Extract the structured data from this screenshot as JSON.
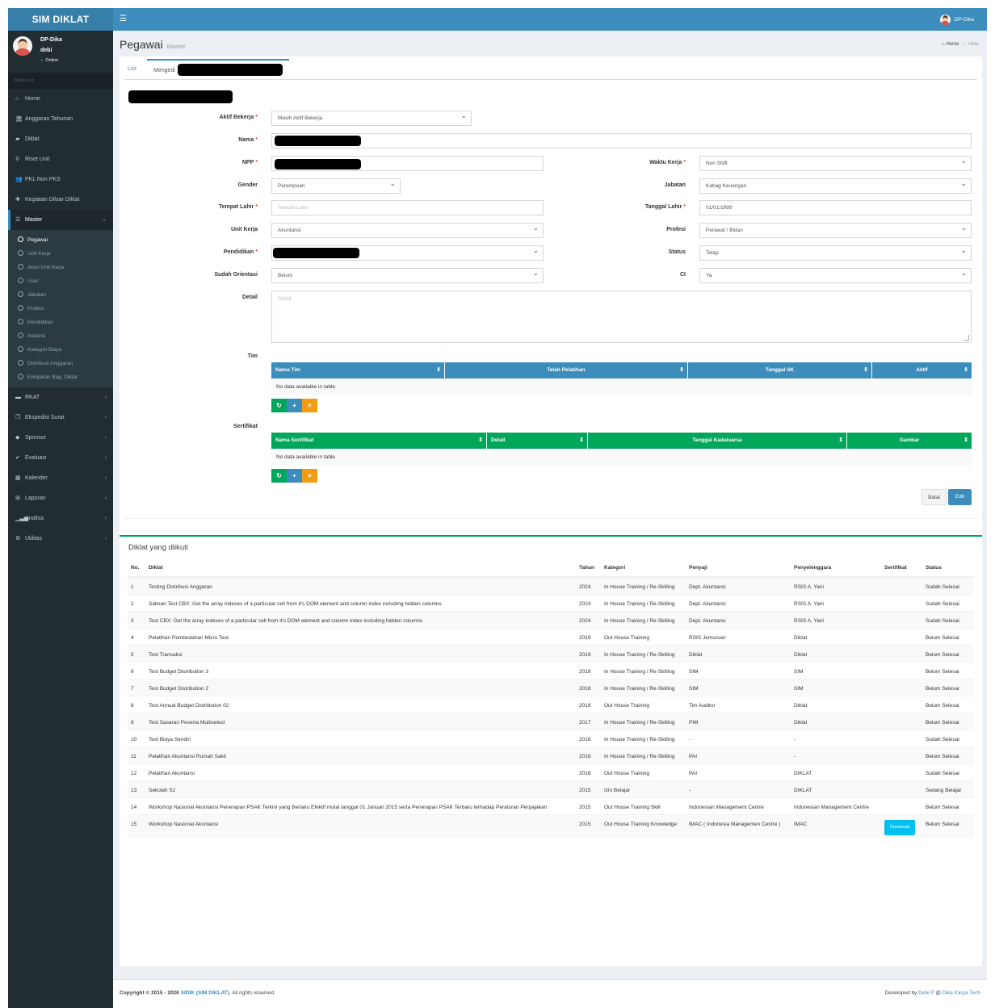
{
  "app": {
    "logo": "SIM DIKLAT",
    "user": "DP-Dika"
  },
  "sidebar": {
    "user_name": "DP-Dika",
    "user_sub": "debi",
    "status": "Online",
    "menu_header": "Menu List",
    "items": [
      {
        "label": "Home",
        "icon": "home-icon",
        "glyph": "⌂"
      },
      {
        "label": "Anggaran Tahunan",
        "icon": "bank-icon",
        "glyph": "🏛"
      },
      {
        "label": "Diklat",
        "icon": "book-icon",
        "glyph": "▰"
      },
      {
        "label": "Riset Unit",
        "icon": "search-icon",
        "glyph": "⚲"
      },
      {
        "label": "PKL Non PKS",
        "icon": "users-icon",
        "glyph": "👥"
      },
      {
        "label": "Kegiatan Diluar Diklat",
        "icon": "puzzle-icon",
        "glyph": "✚"
      },
      {
        "label": "Master",
        "icon": "database-icon",
        "glyph": "☰"
      }
    ],
    "sub": [
      "Pegawai",
      "Unit Kerja",
      "Akun Unit Kerja",
      "User",
      "Jabatan",
      "Profesi",
      "Pendidikan",
      "Instansi",
      "Kategori Biaya",
      "Distribusi Anggaran",
      "Kebijakan Bag. Diklat"
    ],
    "items2": [
      {
        "label": "RKAT",
        "icon": "wallet-icon",
        "glyph": "▬"
      },
      {
        "label": "Ekspedisi Surat",
        "icon": "copy-icon",
        "glyph": "❐"
      },
      {
        "label": "Sponsor",
        "icon": "tag-icon",
        "glyph": "◆"
      },
      {
        "label": "Evaluasi",
        "icon": "check-icon",
        "glyph": "✔"
      },
      {
        "label": "Kalender",
        "icon": "calendar-icon",
        "glyph": "▦"
      },
      {
        "label": "Laporan",
        "icon": "table-icon",
        "glyph": "⊞"
      },
      {
        "label": "Analisa",
        "icon": "chart-icon",
        "glyph": "▁▃▅"
      },
      {
        "label": "Utilitas",
        "icon": "cogs-icon",
        "glyph": "⚙"
      }
    ]
  },
  "page": {
    "title": "Pegawai",
    "subtitle": "Master",
    "breadcrumb_home": "Home",
    "breadcrumb_here": "Here"
  },
  "tabs": {
    "list": "List",
    "edit": "Mengedi"
  },
  "form": {
    "aktif_label": "Aktif Bekerja",
    "aktif_value": "Masih Aktif Bekerja",
    "nama_label": "Nama",
    "npp_label": "NPP",
    "waktu_label": "Waktu Kerja",
    "waktu_value": "Non Shift",
    "gender_label": "Gender",
    "gender_value": "Perempuan",
    "jabatan_label": "Jabatan",
    "jabatan_value": "Kabag Keuangan",
    "tempat_label": "Tempat Lahir",
    "tempat_placeholder": "Tempat Lahir",
    "tgl_label": "Tanggal Lahir",
    "tgl_value": "01/01/1999",
    "unit_label": "Unit Kerja",
    "unit_value": "Akuntansi",
    "profesi_label": "Profesi",
    "profesi_value": "Perawat / Bidan",
    "pendidikan_label": "Pendidikan",
    "status_label": "Status",
    "status_value": "Tetap",
    "orientasi_label": "Sudah Orientasi",
    "orientasi_value": "Belum",
    "ci_label": "CI",
    "ci_value": "Ya",
    "detail_label": "Detail",
    "detail_placeholder": "Detail",
    "tim_label": "Tim",
    "tim_cols": [
      "Nama Tim",
      "Telah Pelatihan",
      "Tanggal SK",
      "Aktif"
    ],
    "no_data": "No data available in table",
    "sert_label": "Sertifikat",
    "sert_cols": [
      "Nama Sertifikat",
      "Detail",
      "Tanggal Kadaluarsa",
      "Gambar"
    ],
    "btn_batal": "Batal",
    "btn_edit": "Edit"
  },
  "colors": {
    "tim_header": "#3c8dbc",
    "sert_header": "#00a65a",
    "accent": "#3c8dbc"
  },
  "diklat": {
    "title": "Diklat yang diikuti",
    "cols": [
      "No.",
      "Diklat",
      "Tahun",
      "Kategori",
      "Penyaji",
      "Penyelenggara",
      "Sertifikat",
      "Status"
    ],
    "rows": [
      [
        "1",
        "Testing Distribusi Anggaran",
        "2024",
        "In House Training / Re-Skilling",
        "Dept. Akuntansi",
        "RSIS A. Yani",
        "",
        "Sudah Selesai"
      ],
      [
        "2",
        "Salinan Test CBX: Get the array indexes of a particular cell from it's DOM element and column index including hidden columns",
        "2024",
        "In House Training / Re-Skilling",
        "Dept. Akuntansi",
        "RSIS A. Yani",
        "",
        "Sudah Selesai"
      ],
      [
        "3",
        "Test CBX: Get the array indexes of a particular cell from it's DOM element and column index including hidden columns",
        "2024",
        "In House Training / Re-Skilling",
        "Dept. Akuntansi",
        "RSIS A. Yani",
        "",
        "Sudah Selesai"
      ],
      [
        "4",
        "Pelatihan Pembedahan Micro Test",
        "2019",
        "Out House Training",
        "RSIS Jemursari",
        "Diklat",
        "",
        "Belum Selesai"
      ],
      [
        "5",
        "Test Transaksi",
        "2019",
        "In House Training / Re-Skilling",
        "Diklat",
        "Diklat",
        "",
        "Belum Selesai"
      ],
      [
        "6",
        "Test Budget Distribution 3",
        "2018",
        "In House Training / Re-Skilling",
        "SIM",
        "SIM",
        "",
        "Belum Selesai"
      ],
      [
        "7",
        "Test Budget Distribution 2",
        "2018",
        "In House Training / Re-Skilling",
        "SIM",
        "SIM",
        "",
        "Belum Selesai"
      ],
      [
        "8",
        "Test Annual Budget Distribution 02",
        "2018",
        "Out House Training",
        "Tim Auditor",
        "Diklat",
        "",
        "Belum Selesai"
      ],
      [
        "9",
        "Test Sasaran Peserta Multiselect",
        "2017",
        "In House Training / Re-Skilling",
        "PMI",
        "Diklat",
        "",
        "Belum Selesai"
      ],
      [
        "10",
        "Test Biaya Sendiri",
        "2016",
        "In House Training / Re-Skilling",
        "-",
        "-",
        "",
        "Sudah Selesai"
      ],
      [
        "11",
        "Pelatihan Akuntansi Rumah Sakit",
        "2016",
        "In House Training / Re-Skilling",
        "PAI",
        "-",
        "",
        "Belum Selesai"
      ],
      [
        "12",
        "Pelatihan Akuntansi",
        "2016",
        "Out House Training",
        "PAI",
        "DIKLAT",
        "",
        "Sudah Selesai"
      ],
      [
        "13",
        "Sekolah S2",
        "2015",
        "Izin Belajar",
        "-",
        "DIKLAT",
        "",
        "Sedang Belajar"
      ],
      [
        "14",
        "Workshop Nasional Akuntansi Penerapan PSAK Terkini yang Berlaku Efektif mulai tanggal 01 Januari 2015 serta Penerapan PSAK Terbaru terhadap Peraturan Perpajakan",
        "2015",
        "Out House Training Skill",
        "Indonesian Management Centre",
        "Indonesian Management Centre",
        "",
        "Belum Selesai"
      ],
      [
        "15",
        "Workshop Nasional Akuntansi",
        "2015",
        "Out House Training Knowledge",
        "IMAC ( Indonesia Managemen Centre )",
        "IMAC",
        "Download",
        "Belum Selesai"
      ]
    ]
  },
  "footer": {
    "copy": "Copyright © 2015 - 2026",
    "app_link": "SIDIK (SIM DIKLAT).",
    "rights": "All rights reserved.",
    "dev": "Developed by",
    "dev_name": "Debi P",
    "at": "@",
    "company": "Dika Karya Tech"
  }
}
